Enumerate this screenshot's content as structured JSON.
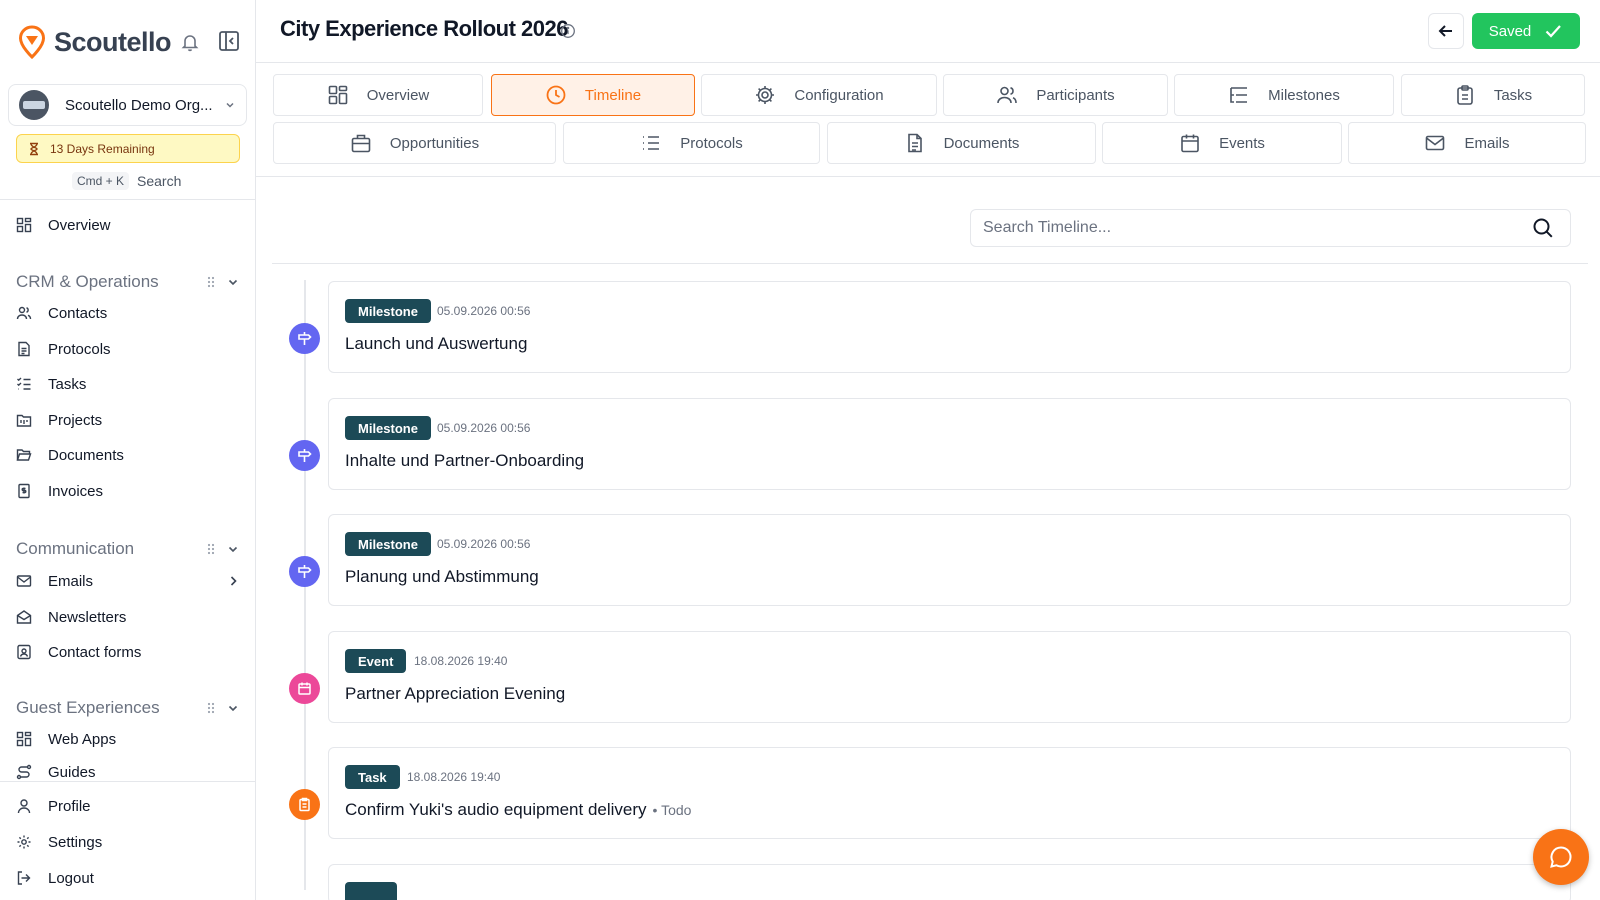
{
  "sidebar": {
    "brand": "Scoutello",
    "org_name": "Scoutello Demo Org...",
    "trial_text": "13 Days Remaining",
    "search_kbd": "Cmd + K",
    "search_label": "Search",
    "overview": "Overview",
    "groups": {
      "crm": "CRM & Operations",
      "communication": "Communication",
      "guest": "Guest Experiences"
    },
    "crm_items": [
      "Contacts",
      "Protocols",
      "Tasks",
      "Projects",
      "Documents",
      "Invoices"
    ],
    "comm_items": [
      "Emails",
      "Newsletters",
      "Contact forms"
    ],
    "guest_items": [
      "Web Apps",
      "Guides"
    ],
    "footer_items": [
      "Profile",
      "Settings",
      "Logout"
    ]
  },
  "header": {
    "title": "City Experience Rollout 2026",
    "saved_label": "Saved"
  },
  "tabs": {
    "row1": [
      "Overview",
      "Timeline",
      "Configuration",
      "Participants",
      "Milestones",
      "Tasks"
    ],
    "row2": [
      "Opportunities",
      "Protocols",
      "Documents",
      "Events",
      "Emails"
    ],
    "active": "Timeline"
  },
  "timeline": {
    "search_placeholder": "Search Timeline...",
    "entries": [
      {
        "type": "Milestone",
        "date": "05.09.2026 00:56",
        "title": "Launch und Auswertung",
        "status": ""
      },
      {
        "type": "Milestone",
        "date": "05.09.2026 00:56",
        "title": "Inhalte und Partner-Onboarding",
        "status": ""
      },
      {
        "type": "Milestone",
        "date": "05.09.2026 00:56",
        "title": "Planung und Abstimmung",
        "status": ""
      },
      {
        "type": "Event",
        "date": "18.08.2026 19:40",
        "title": "Partner Appreciation Evening",
        "status": ""
      },
      {
        "type": "Task",
        "date": "18.08.2026 19:40",
        "title": "Confirm Yuki's audio equipment delivery",
        "status": "• Todo"
      }
    ]
  },
  "colors": {
    "accent": "#f97316",
    "milestone_dot": "#6366f1",
    "event_dot": "#ec4899",
    "task_dot": "#f97316",
    "badge": "#1c4a57",
    "saved": "#22c55e"
  }
}
